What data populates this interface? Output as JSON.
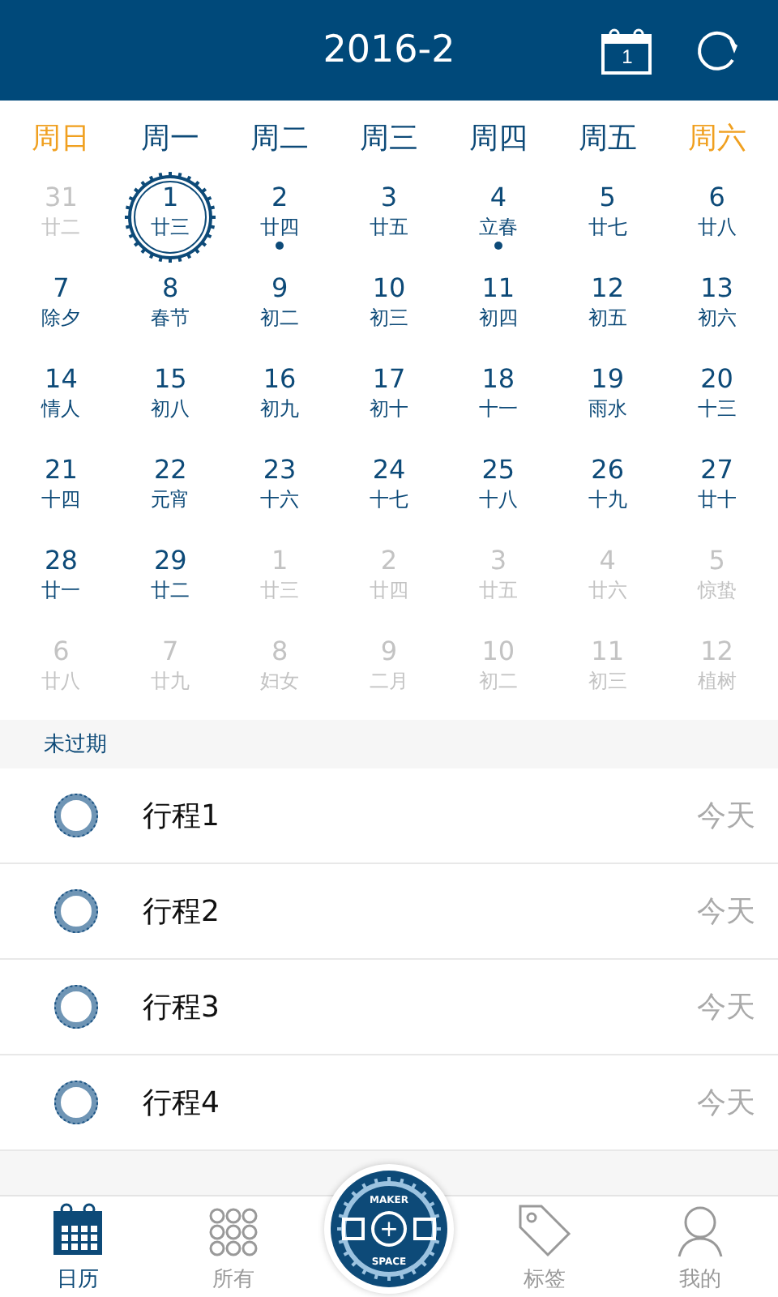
{
  "header": {
    "title": "2016-2",
    "today_icon_day": "1"
  },
  "weekdays": [
    {
      "label": "周日",
      "weekend": true
    },
    {
      "label": "周一",
      "weekend": false
    },
    {
      "label": "周二",
      "weekend": false
    },
    {
      "label": "周三",
      "weekend": false
    },
    {
      "label": "周四",
      "weekend": false
    },
    {
      "label": "周五",
      "weekend": false
    },
    {
      "label": "周六",
      "weekend": true
    }
  ],
  "days": [
    {
      "day": "31",
      "lunar": "廿二",
      "in_month": false,
      "selected": false,
      "has_event": false
    },
    {
      "day": "1",
      "lunar": "廿三",
      "in_month": true,
      "selected": true,
      "has_event": false
    },
    {
      "day": "2",
      "lunar": "廿四",
      "in_month": true,
      "selected": false,
      "has_event": true
    },
    {
      "day": "3",
      "lunar": "廿五",
      "in_month": true,
      "selected": false,
      "has_event": false
    },
    {
      "day": "4",
      "lunar": "立春",
      "in_month": true,
      "selected": false,
      "has_event": true
    },
    {
      "day": "5",
      "lunar": "廿七",
      "in_month": true,
      "selected": false,
      "has_event": false
    },
    {
      "day": "6",
      "lunar": "廿八",
      "in_month": true,
      "selected": false,
      "has_event": false
    },
    {
      "day": "7",
      "lunar": "除夕",
      "in_month": true,
      "selected": false,
      "has_event": false
    },
    {
      "day": "8",
      "lunar": "春节",
      "in_month": true,
      "selected": false,
      "has_event": false
    },
    {
      "day": "9",
      "lunar": "初二",
      "in_month": true,
      "selected": false,
      "has_event": false
    },
    {
      "day": "10",
      "lunar": "初三",
      "in_month": true,
      "selected": false,
      "has_event": false
    },
    {
      "day": "11",
      "lunar": "初四",
      "in_month": true,
      "selected": false,
      "has_event": false
    },
    {
      "day": "12",
      "lunar": "初五",
      "in_month": true,
      "selected": false,
      "has_event": false
    },
    {
      "day": "13",
      "lunar": "初六",
      "in_month": true,
      "selected": false,
      "has_event": false
    },
    {
      "day": "14",
      "lunar": "情人",
      "in_month": true,
      "selected": false,
      "has_event": false
    },
    {
      "day": "15",
      "lunar": "初八",
      "in_month": true,
      "selected": false,
      "has_event": false
    },
    {
      "day": "16",
      "lunar": "初九",
      "in_month": true,
      "selected": false,
      "has_event": false
    },
    {
      "day": "17",
      "lunar": "初十",
      "in_month": true,
      "selected": false,
      "has_event": false
    },
    {
      "day": "18",
      "lunar": "十一",
      "in_month": true,
      "selected": false,
      "has_event": false
    },
    {
      "day": "19",
      "lunar": "雨水",
      "in_month": true,
      "selected": false,
      "has_event": false
    },
    {
      "day": "20",
      "lunar": "十三",
      "in_month": true,
      "selected": false,
      "has_event": false
    },
    {
      "day": "21",
      "lunar": "十四",
      "in_month": true,
      "selected": false,
      "has_event": false
    },
    {
      "day": "22",
      "lunar": "元宵",
      "in_month": true,
      "selected": false,
      "has_event": false
    },
    {
      "day": "23",
      "lunar": "十六",
      "in_month": true,
      "selected": false,
      "has_event": false
    },
    {
      "day": "24",
      "lunar": "十七",
      "in_month": true,
      "selected": false,
      "has_event": false
    },
    {
      "day": "25",
      "lunar": "十八",
      "in_month": true,
      "selected": false,
      "has_event": false
    },
    {
      "day": "26",
      "lunar": "十九",
      "in_month": true,
      "selected": false,
      "has_event": false
    },
    {
      "day": "27",
      "lunar": "廿十",
      "in_month": true,
      "selected": false,
      "has_event": false
    },
    {
      "day": "28",
      "lunar": "廿一",
      "in_month": true,
      "selected": false,
      "has_event": false
    },
    {
      "day": "29",
      "lunar": "廿二",
      "in_month": true,
      "selected": false,
      "has_event": false
    },
    {
      "day": "1",
      "lunar": "廿三",
      "in_month": false,
      "selected": false,
      "has_event": false
    },
    {
      "day": "2",
      "lunar": "廿四",
      "in_month": false,
      "selected": false,
      "has_event": false
    },
    {
      "day": "3",
      "lunar": "廿五",
      "in_month": false,
      "selected": false,
      "has_event": false
    },
    {
      "day": "4",
      "lunar": "廿六",
      "in_month": false,
      "selected": false,
      "has_event": false
    },
    {
      "day": "5",
      "lunar": "惊蛰",
      "in_month": false,
      "selected": false,
      "has_event": false
    },
    {
      "day": "6",
      "lunar": "廿八",
      "in_month": false,
      "selected": false,
      "has_event": false
    },
    {
      "day": "7",
      "lunar": "廿九",
      "in_month": false,
      "selected": false,
      "has_event": false
    },
    {
      "day": "8",
      "lunar": "妇女",
      "in_month": false,
      "selected": false,
      "has_event": false
    },
    {
      "day": "9",
      "lunar": "二月",
      "in_month": false,
      "selected": false,
      "has_event": false
    },
    {
      "day": "10",
      "lunar": "初二",
      "in_month": false,
      "selected": false,
      "has_event": false
    },
    {
      "day": "11",
      "lunar": "初三",
      "in_month": false,
      "selected": false,
      "has_event": false
    },
    {
      "day": "12",
      "lunar": "植树",
      "in_month": false,
      "selected": false,
      "has_event": false
    }
  ],
  "section": {
    "title": "未过期"
  },
  "events": [
    {
      "title": "行程1",
      "when": "今天"
    },
    {
      "title": "行程2",
      "when": "今天"
    },
    {
      "title": "行程3",
      "when": "今天"
    },
    {
      "title": "行程4",
      "when": "今天"
    }
  ],
  "tabs": [
    {
      "label": "日历",
      "kind": "calendar",
      "selected": true
    },
    {
      "label": "所有",
      "kind": "grid",
      "selected": false
    },
    {
      "kind": "center",
      "plus": "+",
      "top_text": "MAKER",
      "bottom_text": "SPACE"
    },
    {
      "label": "标签",
      "kind": "tag",
      "selected": false
    },
    {
      "label": "我的",
      "kind": "person",
      "selected": false
    }
  ]
}
